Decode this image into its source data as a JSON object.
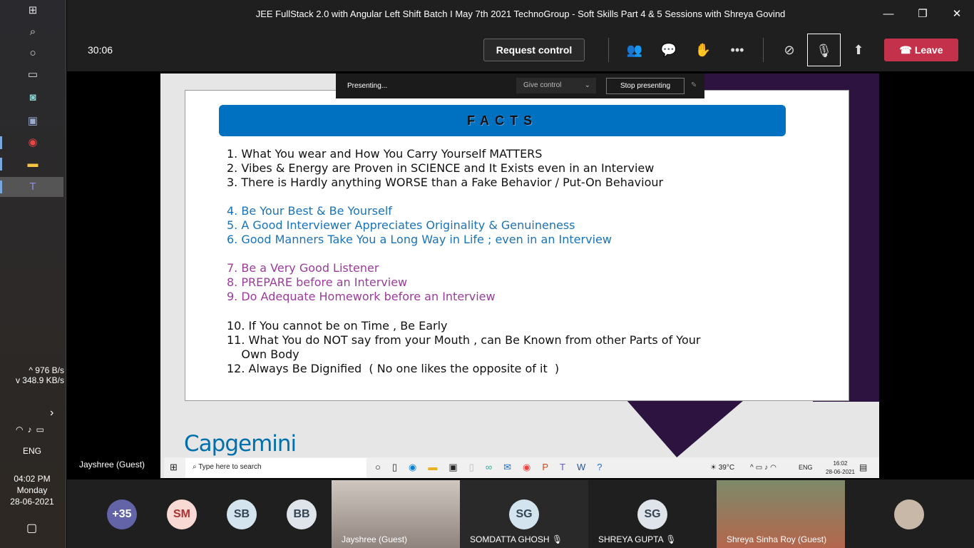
{
  "os": {
    "net_up": "976 B/s",
    "net_down": "348.9 KB/s",
    "lang": "ENG",
    "time": "04:02 PM",
    "day": "Monday",
    "date": "28-06-2021"
  },
  "window": {
    "title": "JEE FullStack 2.0 with Angular Left Shift Batch I May 7th 2021 TechnoGroup - Soft Skills Part 4 & 5 Sessions with Shreya Govind"
  },
  "toolbar": {
    "timer": "30:06",
    "request_control": "Request control",
    "leave": "Leave"
  },
  "presenting": {
    "status": "Presenting...",
    "give_control": "Give control",
    "stop": "Stop presenting"
  },
  "slide": {
    "heading": "FACTS",
    "logo": "Capgemini",
    "items": [
      {
        "n": "1.",
        "t": "What You wear and How You Carry Yourself MATTERS",
        "c": "#111"
      },
      {
        "n": "2.",
        "t": "Vibes & Energy are Proven in SCIENCE and It Exists even in an Interview",
        "c": "#111"
      },
      {
        "n": "3.",
        "t": "There is Hardly anything WORSE than a Fake Behavior / Put-On Behaviour",
        "c": "#111"
      },
      {
        "n": "4.",
        "t": "Be Your Best & Be Yourself",
        "c": "#1a73b8"
      },
      {
        "n": "5.",
        "t": "A Good Interviewer Appreciates Originality & Genuineness",
        "c": "#1a73b8"
      },
      {
        "n": "6.",
        "t": "Good Manners Take You a Long Way in Life ; even in an Interview",
        "c": "#1a73b8"
      },
      {
        "n": "7.",
        "t": "Be a Very Good Listener",
        "c": "#9b3c9b"
      },
      {
        "n": "8.",
        "t": "PREPARE before an Interview",
        "c": "#9b3c9b"
      },
      {
        "n": "9.",
        "t": "Do Adequate Homework before an Interview",
        "c": "#9b3c9b"
      },
      {
        "n": "10.",
        "t": "If You cannot be on Time , Be Early",
        "c": "#111"
      },
      {
        "n": "11.",
        "t": "What You do NOT say from your Mouth , can Be Known from other Parts of Your\n    Own Body",
        "c": "#111"
      },
      {
        "n": "12.",
        "t": "Always Be Dignified  ( No one likes the opposite of it  )",
        "c": "#111"
      }
    ]
  },
  "inner_taskbar": {
    "search_placeholder": "Type here to search",
    "temp": "39°C",
    "lang": "ENG",
    "time": "16:02",
    "date": "28-06-2021"
  },
  "stage_label": "Jayshree (Guest)",
  "participants": {
    "overflow": "+35",
    "avatars": [
      "SM",
      "SB",
      "BB"
    ],
    "tiles": [
      {
        "name": "Jayshree (Guest)"
      },
      {
        "initials": "SG",
        "name": "SOMDATTA GHOSH"
      },
      {
        "initials": "SG",
        "name": "SHREYA GUPTA"
      },
      {
        "name": "Shreya Sinha Roy (Guest)"
      }
    ]
  }
}
